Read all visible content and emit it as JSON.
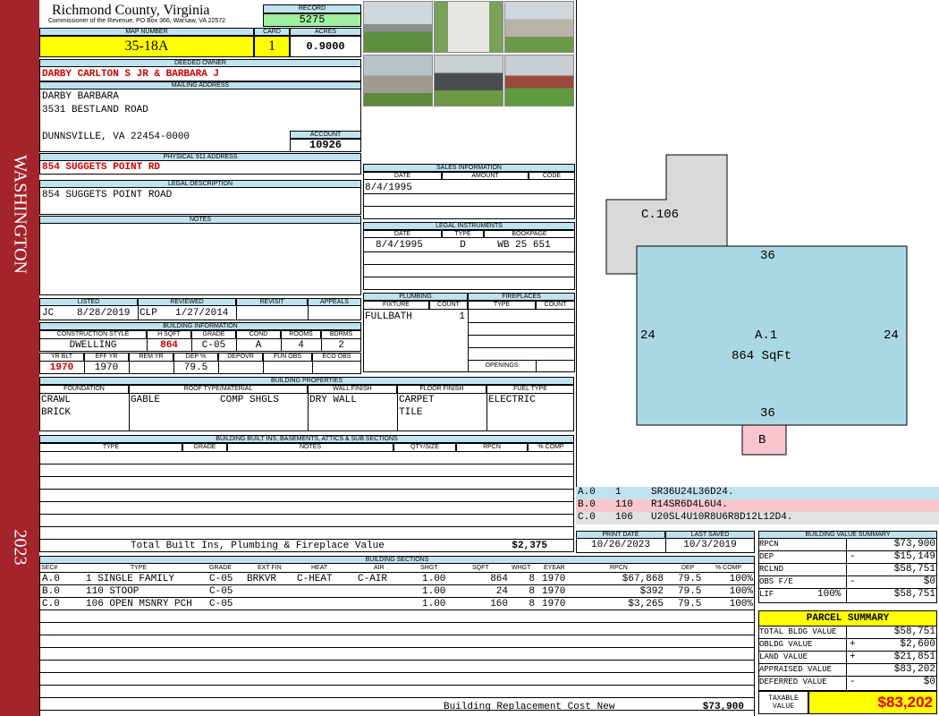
{
  "sidebar": {
    "district": "WASHINGTON",
    "year": "2023"
  },
  "header": {
    "county": "Richmond County, Virginia",
    "address": "Commissioner of the Revenue, PO Box 366, Warsaw, VA 22572",
    "record_label": "RECORD",
    "record": "5275",
    "map_label": "MAP NUMBER",
    "map": "35-18A",
    "card_label": "CARD",
    "card": "1",
    "acres_label": "ACRES",
    "acres": "0.9000"
  },
  "owner": {
    "label": "DEEDED OWNER",
    "name": "DARBY CARLTON S JR & BARBARA J",
    "mail_label": "MAILING ADDRESS",
    "mail1": "DARBY BARBARA",
    "mail2": "3531 BESTLAND ROAD",
    "mail3": "DUNNSVILLE, VA 22454-0000",
    "account_label": "ACCOUNT",
    "account": "10926",
    "phys_label": "PHYSICAL 911 ADDRESS",
    "phys": "854 SUGGETS POINT RD",
    "legal_label": "LEGAL DESCRIPTION",
    "legal": "854 SUGGETS POINT ROAD",
    "notes_label": "NOTES"
  },
  "review": {
    "listed_label": "LISTED",
    "reviewed_label": "REVIEWED",
    "revisit_label": "REVISIT",
    "appeals_label": "APPEALS",
    "listed_by": "JC",
    "listed_date": "8/28/2019",
    "reviewed_by": "CLP",
    "reviewed_date": "1/27/2014"
  },
  "building_info": {
    "label": "BUILDING INFORMATION",
    "h1": "CONSTRUCTION STYLE",
    "h2": "H SQFT",
    "h3": "GRADE",
    "h4": "COND",
    "h5": "ROOMS",
    "h6": "BDRMS",
    "style": "DWELLING",
    "sqft": "864",
    "grade": "C-05",
    "cond": "A",
    "rooms": "4",
    "bdrms": "2",
    "g1": "YR BLT",
    "g2": "EFF YR",
    "g3": "REM YR",
    "g4": "DEP %",
    "g5": "DEPOVR",
    "g6": "FUN OBS",
    "g7": "ECO OBS",
    "yrblt": "1970",
    "effyr": "1970",
    "dep": "79.5"
  },
  "sales": {
    "label": "SALES INFORMATION",
    "date_h": "DATE",
    "amount_h": "AMOUNT",
    "code_h": "CODE",
    "date": "8/4/1995"
  },
  "legal_inst": {
    "label": "LEGAL INSTRUMENTS",
    "date_h": "DATE",
    "type_h": "TYPE",
    "book_h": "BOOKPAGE",
    "date": "8/4/1995",
    "type": "D",
    "book": "WB 25 651"
  },
  "plumbing": {
    "label": "PLUMBING",
    "fixture_h": "FIXTURE",
    "count_h": "COUNT",
    "fixture": "FULLBATH",
    "count": "1"
  },
  "fireplaces": {
    "label": "FIREPLACES",
    "type_h": "TYPE",
    "count_h": "COUNT",
    "openings": "OPENINGS"
  },
  "props": {
    "label": "BUILDING PROPERTIES",
    "h1": "FOUNDATION",
    "h2": "ROOF TYPE/MATERIAL",
    "h3": "WALL FINISH",
    "h4": "FLOOR FINISH",
    "h5": "FUEL TYPE",
    "found1": "CRAWL",
    "found2": "BRICK",
    "roof1": "GABLE",
    "roof2": "COMP SHGLS",
    "wall": "DRY WALL",
    "floor1": "CARPET",
    "floor2": "TILE",
    "fuel": "ELECTRIC"
  },
  "builtins": {
    "label": "BUILDING BUILT INS, BASEMENTS, ATTICS & SUB SECTIONS",
    "h1": "TYPE",
    "h2": "GRADE",
    "h3": "NOTES",
    "h4": "QTY/SIZE",
    "h5": "RPCN",
    "h6": "% COMP",
    "total_label": "Total Built Ins, Plumbing & Fireplace Value",
    "total": "$2,375"
  },
  "print": {
    "print_label": "PRINT DATE",
    "saved_label": "LAST SAVED",
    "print_date": "10/26/2023",
    "saved_date": "10/3/2019"
  },
  "sketch": {
    "c_label": "C.106",
    "a_label": "A.1",
    "a_area": "864 SqFt",
    "b_label": "B",
    "top": "36",
    "bottom": "36",
    "left": "24",
    "right": "24"
  },
  "sketch_codes": [
    {
      "id": "A.0",
      "code": "1",
      "path": "SR36U24L36D24.",
      "color": "#bfe3ee"
    },
    {
      "id": "B.0",
      "code": "110",
      "path": "R14SR6D4L6U4.",
      "color": "#f9c6cf"
    },
    {
      "id": "C.0",
      "code": "106",
      "path": "U20SL4U10R8U6R8D12L12D4.",
      "color": "#e2e2e2"
    }
  ],
  "sections": {
    "label": "BUILDING SECTIONS",
    "headers": [
      "SEC#",
      "TYPE",
      "GRADE",
      "EXT FIN",
      "HEAT",
      "AIR",
      "SHGT",
      "SQFT",
      "WHGT",
      "EYEAR",
      "RPCN",
      "DEP",
      "% COMP"
    ],
    "rows": [
      [
        "A.0",
        "1 SINGLE FAMILY",
        "C-05",
        "BRKVR",
        "C-HEAT",
        "C-AIR",
        "1.00",
        "864",
        "8",
        "1970",
        "$67,868",
        "79.5",
        "100%"
      ],
      [
        "B.0",
        "110 STOOP",
        "C-05",
        "",
        "",
        "",
        "1.00",
        "24",
        "8",
        "1970",
        "$392",
        "79.5",
        "100%"
      ],
      [
        "C.0",
        "106 OPEN MSNRY PCH",
        "C-05",
        "",
        "",
        "",
        "1.00",
        "160",
        "8",
        "1970",
        "$3,265",
        "79.5",
        "100%"
      ]
    ],
    "replacement_label": "Building Replacement Cost New",
    "replacement": "$73,900"
  },
  "bvs": {
    "label": "BUILDING VALUE SUMMARY",
    "rows": [
      {
        "k": "RPCN",
        "op": "",
        "v": "$73,900"
      },
      {
        "k": "DEP",
        "op": "-",
        "v": "$15,149"
      },
      {
        "k": "RCLND",
        "op": "",
        "v": "$58,751"
      },
      {
        "k": "OBS F/E",
        "op": "-",
        "v": "$0"
      },
      {
        "k": "LIF",
        "op": "100%",
        "v": "$58,751"
      }
    ]
  },
  "parcel": {
    "label": "PARCEL SUMMARY",
    "rows": [
      {
        "k": "TOTAL BLDG VALUE",
        "op": "",
        "v": "$58,751"
      },
      {
        "k": "OBLDG VALUE",
        "op": "+",
        "v": "$2,600"
      },
      {
        "k": "LAND VALUE",
        "op": "+",
        "v": "$21,851"
      },
      {
        "k": "APPRAISED VALUE",
        "op": "",
        "v": "$83,202"
      },
      {
        "k": "DEFERRED VALUE",
        "op": "-",
        "v": "$0"
      }
    ],
    "taxable_label": "TAXABLE VALUE",
    "taxable": "$83,202"
  }
}
